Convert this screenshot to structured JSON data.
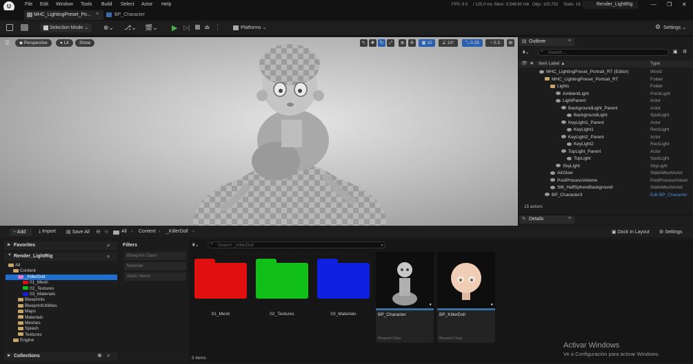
{
  "menu": [
    "File",
    "Edit",
    "Window",
    "Tools",
    "Build",
    "Select",
    "Actor",
    "Help"
  ],
  "tabs": [
    {
      "label": "MHC_LightingPreset_Po..."
    },
    {
      "label": "BP_Character"
    }
  ],
  "stats": {
    "fps": "FPS: 8.0",
    "ms": "/ 125.0 ms",
    "mem": "Mem: 9,548.60 mb",
    "objs": "Objs: 100,702",
    "stalls": "Stalls: 16"
  },
  "window_title": "Render_LightRig",
  "toolbar": {
    "selection_mode": "Selection Mode",
    "platforms": "Platforms",
    "settings": "Settings"
  },
  "viewport": {
    "perspective": "Perspective",
    "lit": "Lit",
    "show": "Show",
    "grid": "10",
    "angle": "10°",
    "speed": "0.25",
    "scale": "0.3"
  },
  "outliner": {
    "tab": "Outliner",
    "search_placeholder": "Search...",
    "col_label": "Item Label ▲",
    "col_type": "Type",
    "footer": "15 actors",
    "rows": [
      {
        "label": "MHC_LightingPreset_Portrait_RT (Editor)",
        "type": "World",
        "indent": 0
      },
      {
        "label": "MHC_LightingPreset_Portrait_RT",
        "type": "Folder",
        "indent": 1
      },
      {
        "label": "Lights",
        "type": "Folder",
        "indent": 2
      },
      {
        "label": "AmbientLight",
        "type": "PointLight",
        "indent": 3
      },
      {
        "label": "LightParent",
        "type": "Actor",
        "indent": 3
      },
      {
        "label": "BackgroundLight_Parent",
        "type": "Actor",
        "indent": 4
      },
      {
        "label": "BackgroundLight",
        "type": "SpotLight",
        "indent": 5
      },
      {
        "label": "KeyLight1_Parent",
        "type": "Actor",
        "indent": 4
      },
      {
        "label": "KeyLight1",
        "type": "RectLight",
        "indent": 5
      },
      {
        "label": "KeyLight2_Parent",
        "type": "Actor",
        "indent": 4
      },
      {
        "label": "KeyLight2",
        "type": "RectLight",
        "indent": 5
      },
      {
        "label": "TopLight_Parent",
        "type": "Actor",
        "indent": 4
      },
      {
        "label": "TopLight",
        "type": "SpotLight",
        "indent": 5
      },
      {
        "label": "SkyLight",
        "type": "SkyLight",
        "indent": 3
      },
      {
        "label": "AirGlow",
        "type": "StaticMeshActor",
        "indent": 2
      },
      {
        "label": "PostProcessVolume",
        "type": "PostProcessVolum",
        "indent": 2
      },
      {
        "label": "SM_HalfSphereBackground",
        "type": "StaticMeshActor",
        "indent": 2
      },
      {
        "label": "BP_Character3",
        "type": "Edit BP_Character",
        "indent": 1
      }
    ]
  },
  "details": {
    "tab": "Details",
    "dock": "Dock in Layout",
    "settings": "Settings"
  },
  "content_browser": {
    "add": "Add",
    "import": "Import",
    "save_all": "Save All",
    "path": [
      "All",
      "Content",
      "_KillerDoll"
    ],
    "favorites": "Favorites",
    "root": "Render_LightRig",
    "tree": [
      {
        "label": "All",
        "indent": 0
      },
      {
        "label": "Content",
        "indent": 1
      },
      {
        "label": "_KillerDoll",
        "indent": 2,
        "selected": true
      },
      {
        "label": "01_Mesh",
        "indent": 3
      },
      {
        "label": "02_Textures",
        "indent": 3
      },
      {
        "label": "03_Materials",
        "indent": 3
      },
      {
        "label": "Blueprints",
        "indent": 2
      },
      {
        "label": "BlueprintUtilities",
        "indent": 2
      },
      {
        "label": "Maps",
        "indent": 2
      },
      {
        "label": "Materials",
        "indent": 2
      },
      {
        "label": "Meshes",
        "indent": 2
      },
      {
        "label": "Splash",
        "indent": 2
      },
      {
        "label": "Textures",
        "indent": 2
      },
      {
        "label": "Engine",
        "indent": 1
      }
    ],
    "filters_title": "Filters",
    "filters": [
      "Blueprint Class",
      "Material",
      "Static Mesh"
    ],
    "search_placeholder": "Search _KillerDoll",
    "assets": [
      {
        "label": "01_Mesh",
        "kind": "folder",
        "color": "#e01010"
      },
      {
        "label": "02_Textures",
        "kind": "folder",
        "color": "#10c018"
      },
      {
        "label": "03_Materials",
        "kind": "folder",
        "color": "#1020e0"
      },
      {
        "label": "BP_Character",
        "kind": "blueprint",
        "sub": "Blueprint Class"
      },
      {
        "label": "BP_KillerDoll",
        "kind": "blueprint",
        "sub": "Blueprint Class"
      }
    ],
    "item_count": "5 items",
    "collections": "Collections"
  },
  "watermark": {
    "line1": "Activar Windows",
    "line2": "Ve a Configuración para activar Windows."
  }
}
